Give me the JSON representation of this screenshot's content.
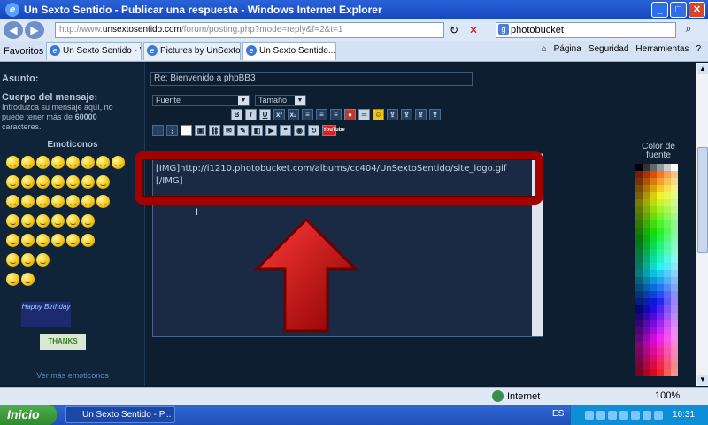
{
  "window": {
    "title": "Un Sexto Sentido - Publicar una respuesta - Windows Internet Explorer"
  },
  "address": {
    "url_prefix": "http://www.",
    "url_domain": "unsextosentido.com",
    "url_rest": "/forum/posting.php?mode=reply&f=2&t=1"
  },
  "search": {
    "value": "photobucket"
  },
  "tabs": {
    "favorites_label": "Favoritos",
    "items": [
      {
        "label": "Un Sexto Sentido - V..."
      },
      {
        "label": "Pictures by UnSexto..."
      },
      {
        "label": "Un Sexto Sentido..."
      }
    ],
    "tools": [
      "Página",
      "Seguridad",
      "Herramientas"
    ]
  },
  "form": {
    "asunto_label": "Asunto:",
    "asunto_value": "Re: Bienvenido a phpBB3",
    "cuerpo_label": "Cuerpo del mensaje:",
    "cuerpo_desc_1": "Introduzca su mensaje aquí, no puede tener más de ",
    "cuerpo_desc_max": "60000",
    "cuerpo_desc_2": " caracteres.",
    "emoticonos_title": "Emoticonos",
    "birthday_text": "Happy Birthday",
    "thanks_text": "THANKS",
    "ver_mas": "Ver más emoticonos",
    "font_select": "Fuente",
    "size_select": "Tamaño",
    "message_line1": "[IMG]http://i1210.photobucket.com/albums/cc404/UnSextoSentido/site_logo.gif",
    "message_line2": "[/IMG]",
    "color_label": "Color de fuente"
  },
  "toolbar": {
    "bold": "B",
    "italic": "I",
    "underline": "U",
    "youtube": "YouTube"
  },
  "status": {
    "zone": "Internet",
    "zoom": "100%"
  },
  "taskbar": {
    "start": "Inicio",
    "task": "Un Sexto Sentido - P...",
    "lang": "ES",
    "clock": "16:31"
  },
  "colors": {
    "highlight": "#a50000",
    "arrow": "#c00000"
  }
}
